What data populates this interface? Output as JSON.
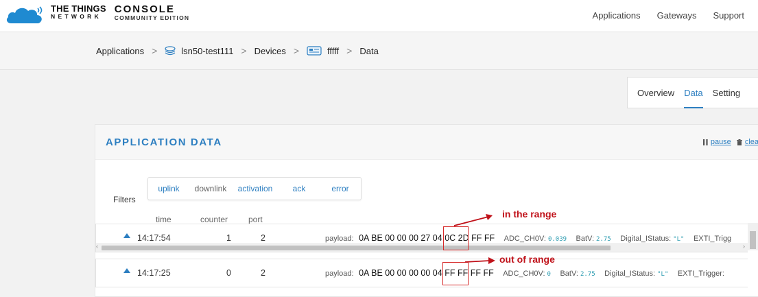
{
  "header": {
    "brand_line1": "THE THINGS",
    "brand_line2": "NETWORK",
    "console_title": "CONSOLE",
    "console_sub": "COMMUNITY EDITION",
    "nav": [
      "Applications",
      "Gateways",
      "Support"
    ]
  },
  "breadcrumb": {
    "items": [
      "Applications",
      "lsn50-test111",
      "Devices",
      "fffff",
      "Data"
    ],
    "separator": ">"
  },
  "tabs": {
    "items": [
      "Overview",
      "Data",
      "Setting"
    ],
    "active": "Data"
  },
  "panel": {
    "title": "APPLICATION DATA",
    "pause_label": "pause",
    "clear_label": "clea"
  },
  "filters": {
    "label": "Filters",
    "items": [
      "uplink",
      "downlink",
      "activation",
      "ack",
      "error"
    ]
  },
  "columns": {
    "time": "time",
    "counter": "counter",
    "port": "port"
  },
  "rows": [
    {
      "time": "14:17:54",
      "counter": "1",
      "port": "2",
      "payload_label": "payload:",
      "hex_before": "0A BE 00 00 00 27 04",
      "hex_highlight": "0C 2D",
      "hex_after": "FF FF",
      "adc_label": "ADC_CH0V:",
      "adc_value": "0.039",
      "bat_label": "BatV:",
      "bat_value": "2.75",
      "dig_label": "Digital_IStatus:",
      "dig_value": "\"L\"",
      "exti_label": "EXTI_Trigg"
    },
    {
      "time": "14:17:25",
      "counter": "0",
      "port": "2",
      "payload_label": "payload:",
      "hex_before": "0A BE 00 00 00 00 04",
      "hex_highlight": "FF FF",
      "hex_after": "FF FF",
      "adc_label": "ADC_CH0V:",
      "adc_value": "0",
      "bat_label": "BatV:",
      "bat_value": "2.75",
      "dig_label": "Digital_IStatus:",
      "dig_value": "\"L\"",
      "exti_label": "EXTI_Trigger:"
    }
  ],
  "annotations": {
    "first": "in the range",
    "second": "out of range"
  },
  "colors": {
    "accent": "#2d7fc1",
    "annotation": "#c0121a",
    "value": "#2a9bb0"
  }
}
